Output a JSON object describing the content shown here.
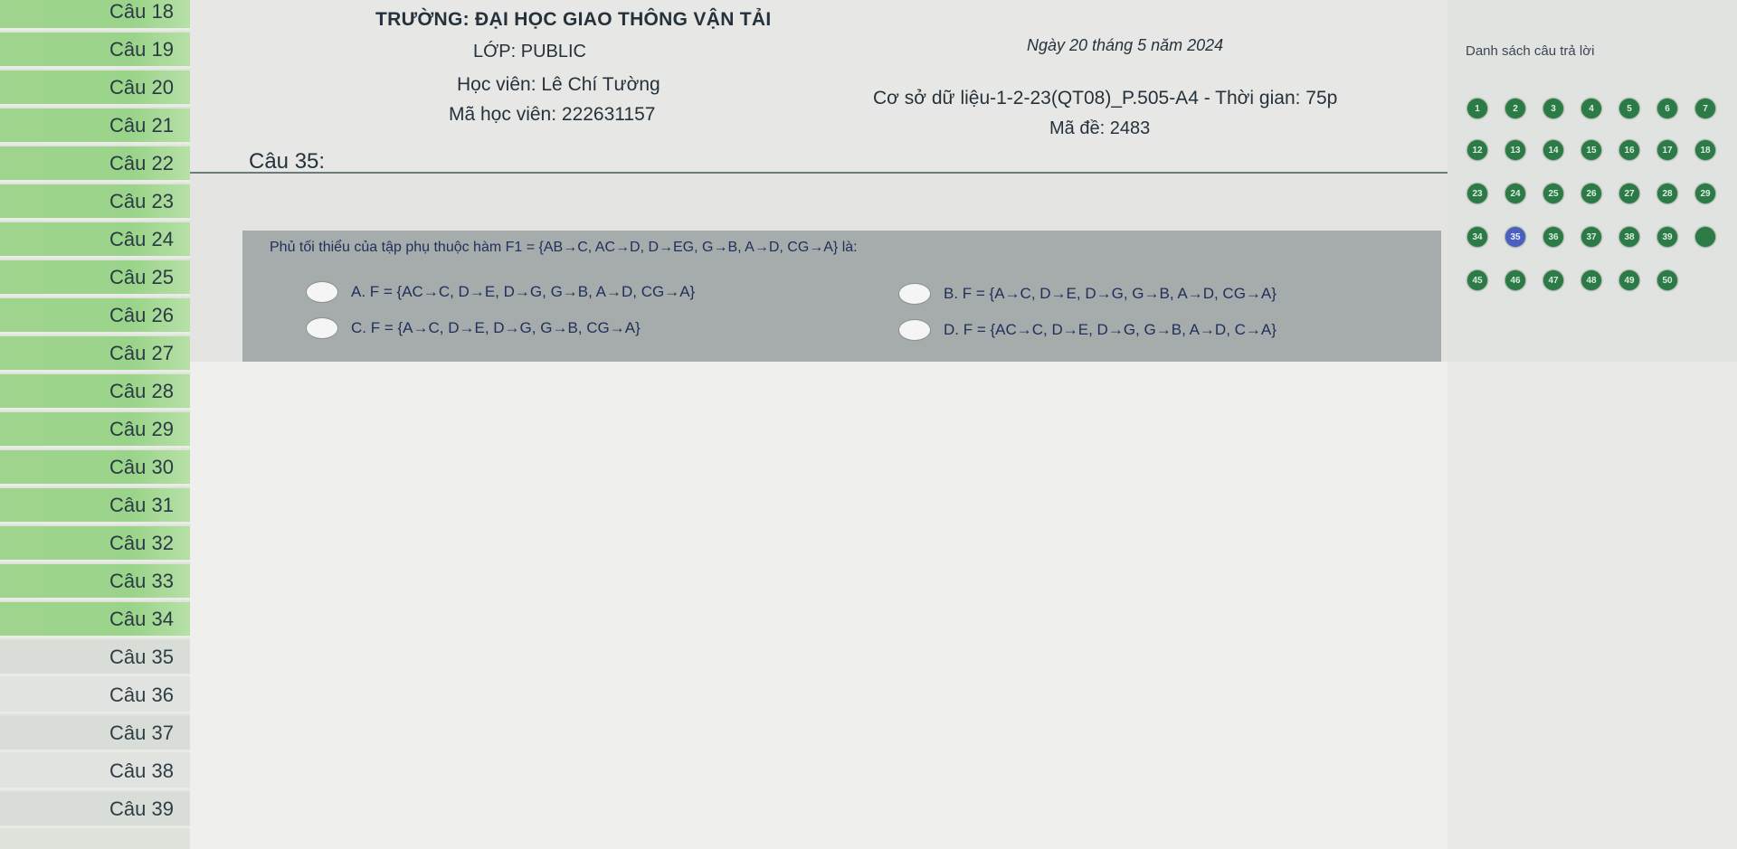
{
  "sidebar": {
    "items": [
      {
        "label": "Câu 18",
        "answered": true
      },
      {
        "label": "Câu 19",
        "answered": true
      },
      {
        "label": "Câu 20",
        "answered": true
      },
      {
        "label": "Câu 21",
        "answered": true
      },
      {
        "label": "Câu 22",
        "answered": true
      },
      {
        "label": "Câu 23",
        "answered": true
      },
      {
        "label": "Câu 24",
        "answered": true
      },
      {
        "label": "Câu 25",
        "answered": true
      },
      {
        "label": "Câu 26",
        "answered": true
      },
      {
        "label": "Câu 27",
        "answered": true
      },
      {
        "label": "Câu 28",
        "answered": true
      },
      {
        "label": "Câu 29",
        "answered": true
      },
      {
        "label": "Câu 30",
        "answered": true
      },
      {
        "label": "Câu 31",
        "answered": true
      },
      {
        "label": "Câu 32",
        "answered": true
      },
      {
        "label": "Câu 33",
        "answered": true
      },
      {
        "label": "Câu 34",
        "answered": true
      },
      {
        "label": "Câu 35",
        "answered": false
      },
      {
        "label": "Câu 36",
        "answered": false
      },
      {
        "label": "Câu 37",
        "answered": false
      },
      {
        "label": "Câu 38",
        "answered": false
      },
      {
        "label": "Câu 39",
        "answered": false
      }
    ]
  },
  "header": {
    "school": "TRƯỜNG: ĐẠI HỌC GIAO THÔNG VẬN TẢI",
    "class_name": "LỚP: PUBLIC",
    "student": "Học viên: Lê Chí Tường",
    "student_id": "Mã học viên: 222631157",
    "date": "Ngày 20 tháng 5 năm 2024",
    "exam": "Cơ sở dữ liệu-1-2-23(QT08)_P.505-A4 - Thời gian: 75p",
    "code": "Mã đề: 2483"
  },
  "question": {
    "title": "Câu 35:",
    "stem": "Phủ tối thiểu của tập phụ thuộc hàm F1 = {AB→C, AC→D, D→EG, G→B, A→D, CG→A} là:",
    "options": {
      "a": "A. F = {AC→C, D→E, D→G, G→B, A→D, CG→A}",
      "b": "B. F = {A→C, D→E, D→G, G→B, A→D, CG→A}",
      "c": "C. F = {A→C, D→E, D→G, G→B, CG→A}",
      "d": "D. F = {AC→C, D→E, D→G, G→B, A→D, C→A}"
    }
  },
  "answer_panel": {
    "title": "Danh sách câu trả lời",
    "rows": [
      [
        "1",
        "2",
        "3",
        "4",
        "5",
        "6",
        "7"
      ],
      [
        "12",
        "13",
        "14",
        "15",
        "16",
        "17",
        "18"
      ],
      [
        "23",
        "24",
        "25",
        "26",
        "27",
        "28",
        "29"
      ],
      [
        "34",
        "35",
        "36",
        "37",
        "38",
        "39",
        ""
      ],
      [
        "45",
        "46",
        "47",
        "48",
        "49",
        "50"
      ]
    ],
    "current": "35",
    "colors": {
      "answered": "#2c7a45",
      "current": "#4a5fc0"
    }
  }
}
